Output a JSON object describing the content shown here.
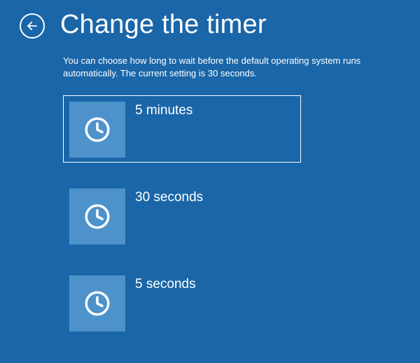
{
  "header": {
    "title": "Change the timer"
  },
  "description": "You can choose how long to wait before the default operating system runs automatically. The current setting is 30 seconds.",
  "options": [
    {
      "label": "5 minutes",
      "selected": true
    },
    {
      "label": "30 seconds",
      "selected": false
    },
    {
      "label": "5 seconds",
      "selected": false
    }
  ]
}
